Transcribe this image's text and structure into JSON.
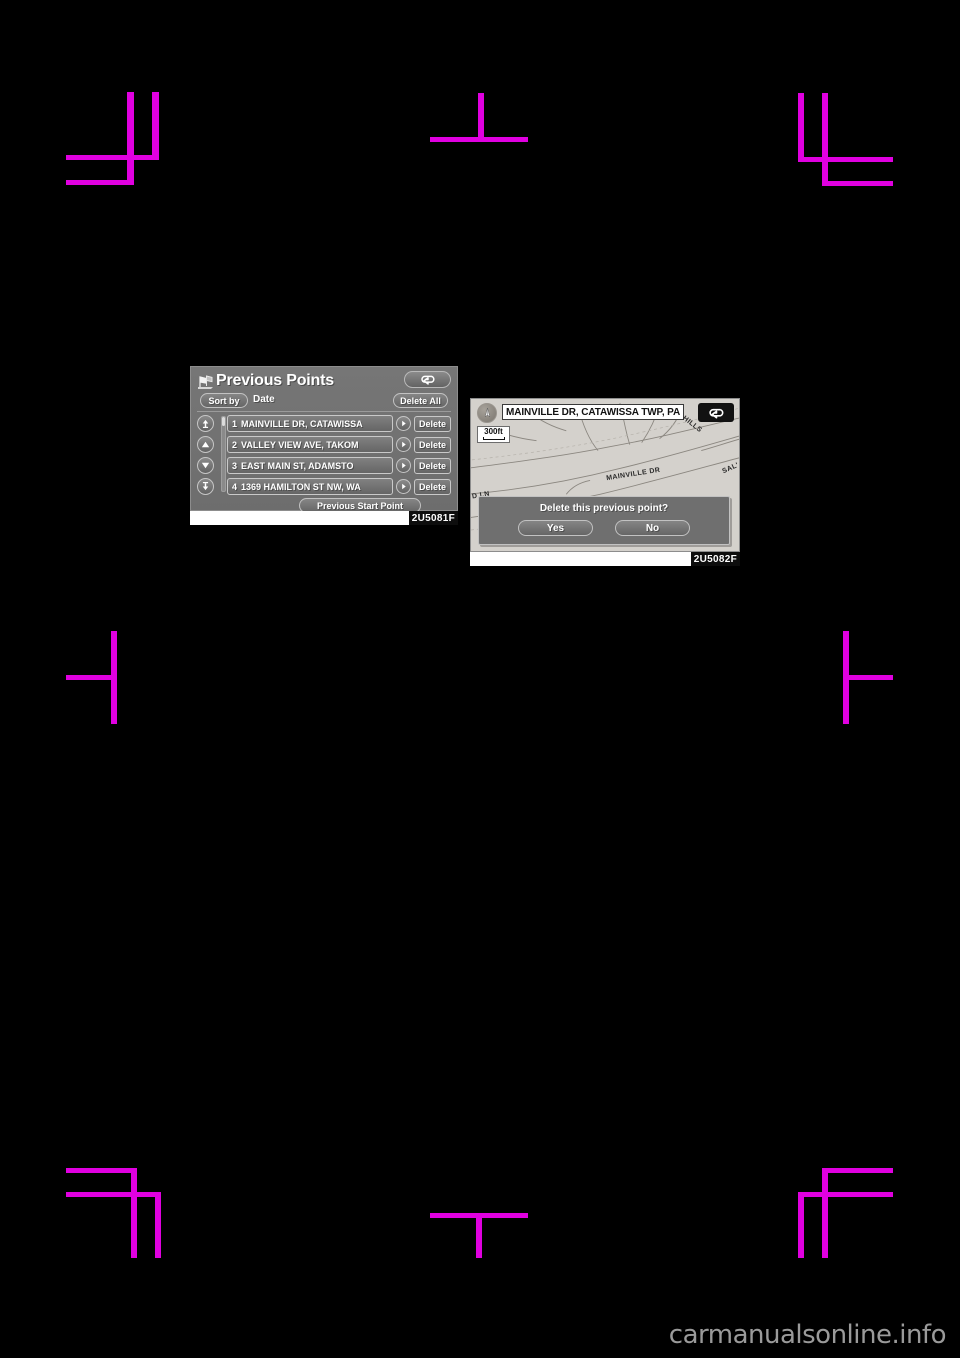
{
  "page": {
    "background_color": "#000000",
    "crop_mark_color": "#e000e0",
    "watermark": "carmanualsonline.info"
  },
  "figures": [
    {
      "code": "2U5081F",
      "screen": {
        "title": "Previous Points",
        "title_icon": "previous-points-icon",
        "back_icon": "back-arrow-icon",
        "sort_by_label": "Sort by",
        "sort_by_value": "Date",
        "delete_all_label": "Delete All",
        "scroll_buttons": [
          "scroll-to-top-icon",
          "scroll-up-icon",
          "scroll-down-icon",
          "scroll-to-bottom-icon"
        ],
        "rows": [
          {
            "number": "1",
            "label": "MAINVILLE DR, CATAWISSA",
            "arrow_icon": "play-arrow-icon",
            "delete_label": "Delete"
          },
          {
            "number": "2",
            "label": "VALLEY VIEW AVE, TAKOM",
            "arrow_icon": "play-arrow-icon",
            "delete_label": "Delete"
          },
          {
            "number": "3",
            "label": "EAST MAIN ST, ADAMSTO",
            "arrow_icon": "play-arrow-icon",
            "delete_label": "Delete"
          },
          {
            "number": "4",
            "label": "1369 HAMILTON ST NW, WA",
            "arrow_icon": "play-arrow-icon",
            "delete_label": "Delete"
          }
        ],
        "previous_start_point_label": "Previous Start Point"
      }
    },
    {
      "code": "2U5082F",
      "screen": {
        "street_label": "MAINVILLE DR, CATAWISSA TWP, PA",
        "compass_icon": "compass-icon",
        "back_icon": "back-arrow-icon",
        "scale_value": "300ft",
        "map_labels": [
          "HILLS",
          "MAINVILLE DR",
          "SAL'",
          "D LN"
        ],
        "dialog": {
          "message": "Delete this previous point?",
          "yes_label": "Yes",
          "no_label": "No"
        }
      }
    }
  ]
}
